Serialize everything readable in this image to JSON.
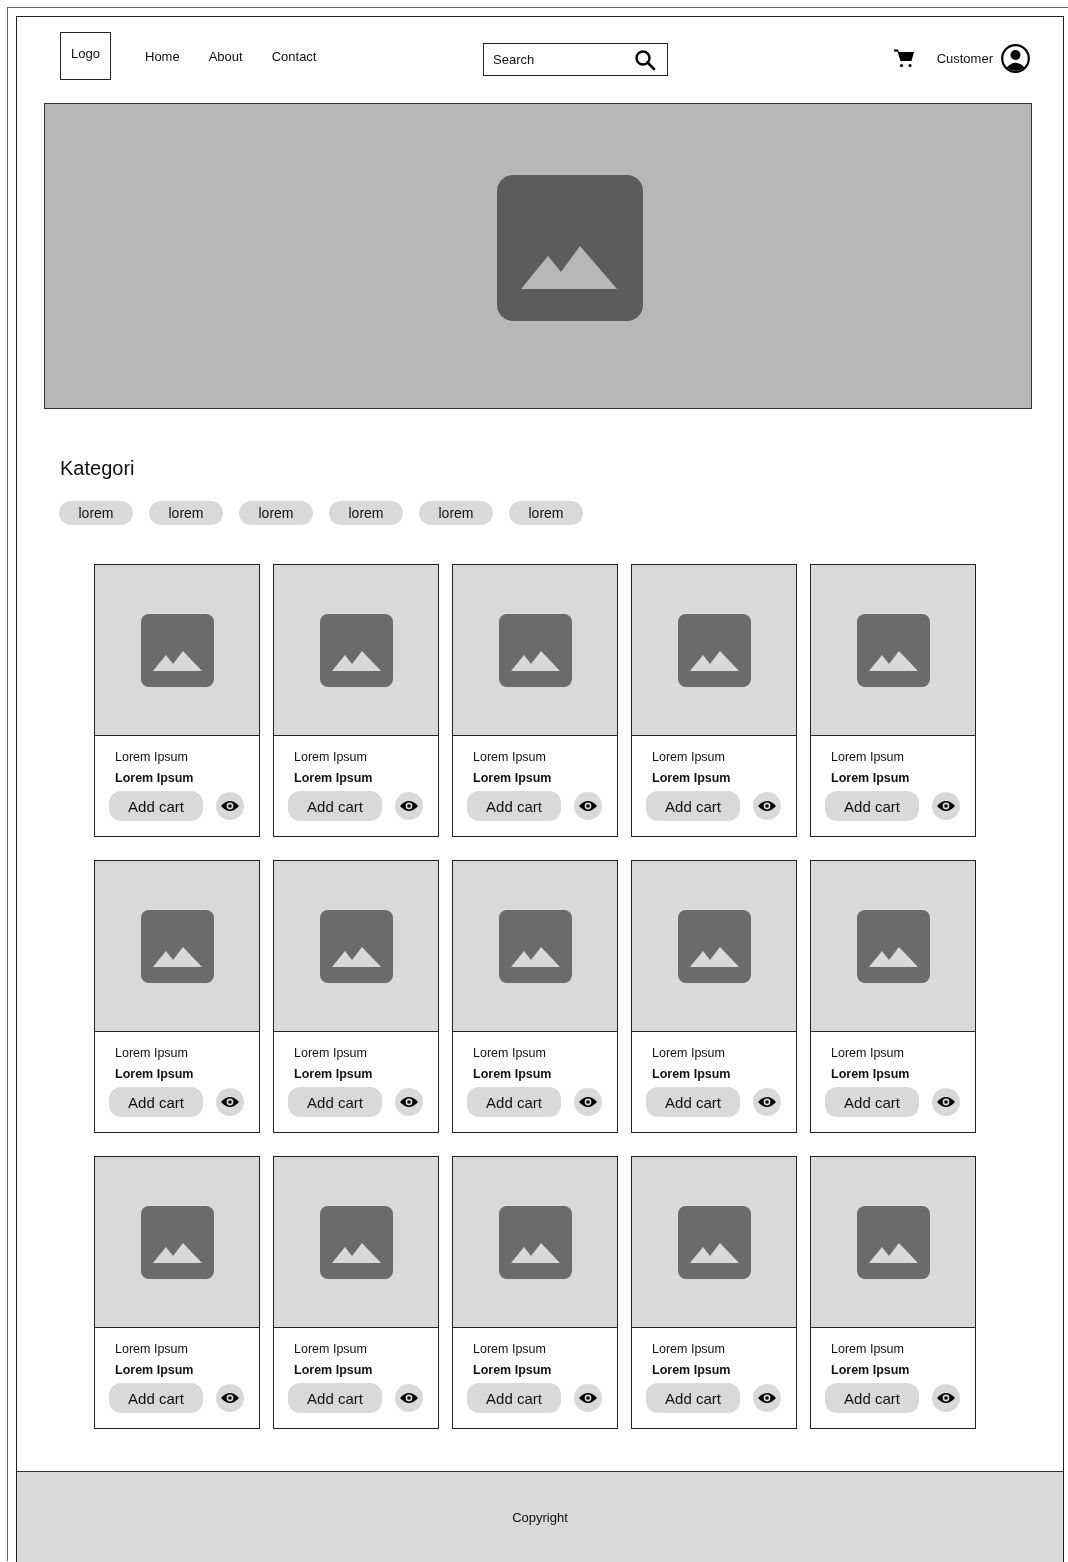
{
  "header": {
    "logo": "Logo",
    "nav": [
      "Home",
      "About",
      "Contact"
    ],
    "search": {
      "placeholder": "Search"
    },
    "account": "Customer"
  },
  "categories": {
    "title": "Kategori",
    "items": [
      "lorem",
      "lorem",
      "lorem",
      "lorem",
      "lorem",
      "lorem"
    ]
  },
  "products": [
    {
      "name": "Lorem Ipsum",
      "price": "Lorem Ipsum",
      "button": "Add cart"
    },
    {
      "name": "Lorem Ipsum",
      "price": "Lorem Ipsum",
      "button": "Add cart"
    },
    {
      "name": "Lorem Ipsum",
      "price": "Lorem Ipsum",
      "button": "Add cart"
    },
    {
      "name": "Lorem Ipsum",
      "price": "Lorem Ipsum",
      "button": "Add cart"
    },
    {
      "name": "Lorem Ipsum",
      "price": "Lorem Ipsum",
      "button": "Add cart"
    },
    {
      "name": "Lorem Ipsum",
      "price": "Lorem Ipsum",
      "button": "Add cart"
    },
    {
      "name": "Lorem Ipsum",
      "price": "Lorem Ipsum",
      "button": "Add cart"
    },
    {
      "name": "Lorem Ipsum",
      "price": "Lorem Ipsum",
      "button": "Add cart"
    },
    {
      "name": "Lorem Ipsum",
      "price": "Lorem Ipsum",
      "button": "Add cart"
    },
    {
      "name": "Lorem Ipsum",
      "price": "Lorem Ipsum",
      "button": "Add cart"
    },
    {
      "name": "Lorem Ipsum",
      "price": "Lorem Ipsum",
      "button": "Add cart"
    },
    {
      "name": "Lorem Ipsum",
      "price": "Lorem Ipsum",
      "button": "Add cart"
    },
    {
      "name": "Lorem Ipsum",
      "price": "Lorem Ipsum",
      "button": "Add cart"
    },
    {
      "name": "Lorem Ipsum",
      "price": "Lorem Ipsum",
      "button": "Add cart"
    },
    {
      "name": "Lorem Ipsum",
      "price": "Lorem Ipsum",
      "button": "Add cart"
    }
  ],
  "footer": {
    "text": "Copyright"
  }
}
